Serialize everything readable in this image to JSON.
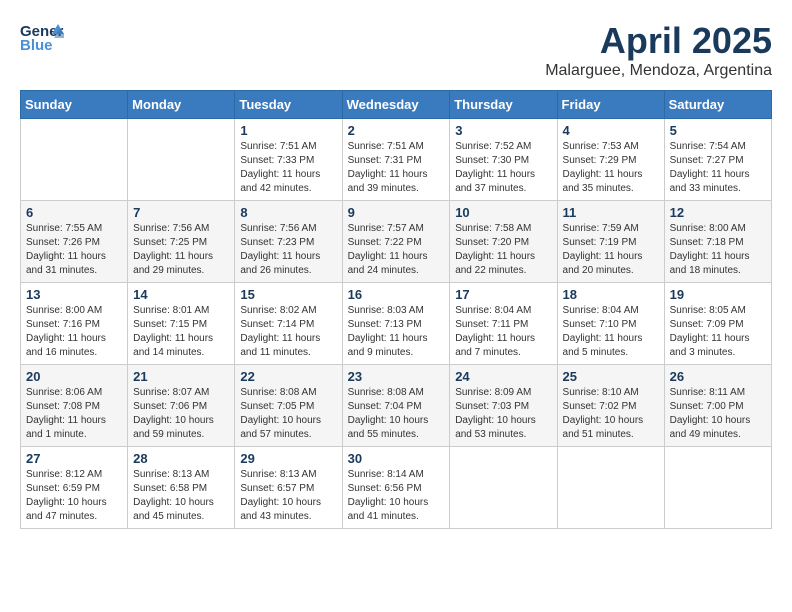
{
  "header": {
    "logo_line1": "General",
    "logo_line2": "Blue",
    "month": "April 2025",
    "location": "Malarguee, Mendoza, Argentina"
  },
  "weekdays": [
    "Sunday",
    "Monday",
    "Tuesday",
    "Wednesday",
    "Thursday",
    "Friday",
    "Saturday"
  ],
  "weeks": [
    [
      {
        "day": "",
        "info": ""
      },
      {
        "day": "",
        "info": ""
      },
      {
        "day": "1",
        "info": "Sunrise: 7:51 AM\nSunset: 7:33 PM\nDaylight: 11 hours and 42 minutes."
      },
      {
        "day": "2",
        "info": "Sunrise: 7:51 AM\nSunset: 7:31 PM\nDaylight: 11 hours and 39 minutes."
      },
      {
        "day": "3",
        "info": "Sunrise: 7:52 AM\nSunset: 7:30 PM\nDaylight: 11 hours and 37 minutes."
      },
      {
        "day": "4",
        "info": "Sunrise: 7:53 AM\nSunset: 7:29 PM\nDaylight: 11 hours and 35 minutes."
      },
      {
        "day": "5",
        "info": "Sunrise: 7:54 AM\nSunset: 7:27 PM\nDaylight: 11 hours and 33 minutes."
      }
    ],
    [
      {
        "day": "6",
        "info": "Sunrise: 7:55 AM\nSunset: 7:26 PM\nDaylight: 11 hours and 31 minutes."
      },
      {
        "day": "7",
        "info": "Sunrise: 7:56 AM\nSunset: 7:25 PM\nDaylight: 11 hours and 29 minutes."
      },
      {
        "day": "8",
        "info": "Sunrise: 7:56 AM\nSunset: 7:23 PM\nDaylight: 11 hours and 26 minutes."
      },
      {
        "day": "9",
        "info": "Sunrise: 7:57 AM\nSunset: 7:22 PM\nDaylight: 11 hours and 24 minutes."
      },
      {
        "day": "10",
        "info": "Sunrise: 7:58 AM\nSunset: 7:20 PM\nDaylight: 11 hours and 22 minutes."
      },
      {
        "day": "11",
        "info": "Sunrise: 7:59 AM\nSunset: 7:19 PM\nDaylight: 11 hours and 20 minutes."
      },
      {
        "day": "12",
        "info": "Sunrise: 8:00 AM\nSunset: 7:18 PM\nDaylight: 11 hours and 18 minutes."
      }
    ],
    [
      {
        "day": "13",
        "info": "Sunrise: 8:00 AM\nSunset: 7:16 PM\nDaylight: 11 hours and 16 minutes."
      },
      {
        "day": "14",
        "info": "Sunrise: 8:01 AM\nSunset: 7:15 PM\nDaylight: 11 hours and 14 minutes."
      },
      {
        "day": "15",
        "info": "Sunrise: 8:02 AM\nSunset: 7:14 PM\nDaylight: 11 hours and 11 minutes."
      },
      {
        "day": "16",
        "info": "Sunrise: 8:03 AM\nSunset: 7:13 PM\nDaylight: 11 hours and 9 minutes."
      },
      {
        "day": "17",
        "info": "Sunrise: 8:04 AM\nSunset: 7:11 PM\nDaylight: 11 hours and 7 minutes."
      },
      {
        "day": "18",
        "info": "Sunrise: 8:04 AM\nSunset: 7:10 PM\nDaylight: 11 hours and 5 minutes."
      },
      {
        "day": "19",
        "info": "Sunrise: 8:05 AM\nSunset: 7:09 PM\nDaylight: 11 hours and 3 minutes."
      }
    ],
    [
      {
        "day": "20",
        "info": "Sunrise: 8:06 AM\nSunset: 7:08 PM\nDaylight: 11 hours and 1 minute."
      },
      {
        "day": "21",
        "info": "Sunrise: 8:07 AM\nSunset: 7:06 PM\nDaylight: 10 hours and 59 minutes."
      },
      {
        "day": "22",
        "info": "Sunrise: 8:08 AM\nSunset: 7:05 PM\nDaylight: 10 hours and 57 minutes."
      },
      {
        "day": "23",
        "info": "Sunrise: 8:08 AM\nSunset: 7:04 PM\nDaylight: 10 hours and 55 minutes."
      },
      {
        "day": "24",
        "info": "Sunrise: 8:09 AM\nSunset: 7:03 PM\nDaylight: 10 hours and 53 minutes."
      },
      {
        "day": "25",
        "info": "Sunrise: 8:10 AM\nSunset: 7:02 PM\nDaylight: 10 hours and 51 minutes."
      },
      {
        "day": "26",
        "info": "Sunrise: 8:11 AM\nSunset: 7:00 PM\nDaylight: 10 hours and 49 minutes."
      }
    ],
    [
      {
        "day": "27",
        "info": "Sunrise: 8:12 AM\nSunset: 6:59 PM\nDaylight: 10 hours and 47 minutes."
      },
      {
        "day": "28",
        "info": "Sunrise: 8:13 AM\nSunset: 6:58 PM\nDaylight: 10 hours and 45 minutes."
      },
      {
        "day": "29",
        "info": "Sunrise: 8:13 AM\nSunset: 6:57 PM\nDaylight: 10 hours and 43 minutes."
      },
      {
        "day": "30",
        "info": "Sunrise: 8:14 AM\nSunset: 6:56 PM\nDaylight: 10 hours and 41 minutes."
      },
      {
        "day": "",
        "info": ""
      },
      {
        "day": "",
        "info": ""
      },
      {
        "day": "",
        "info": ""
      }
    ]
  ]
}
